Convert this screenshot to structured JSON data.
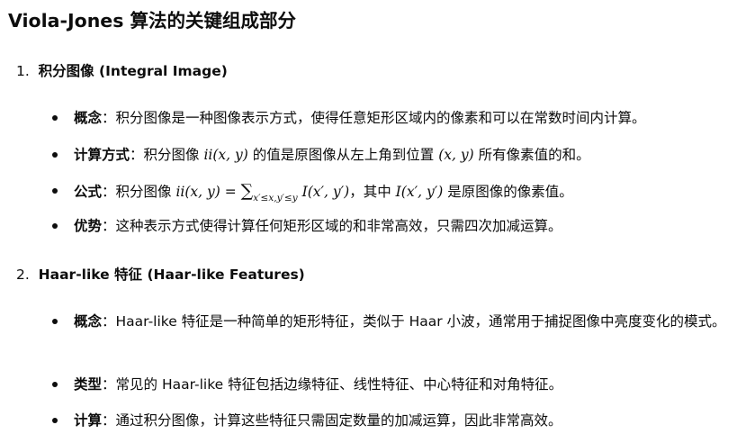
{
  "title": "Viola-Jones 算法的关键组成部分",
  "sections": [
    {
      "number": "1.",
      "title": "积分图像 (Integral Image)",
      "bullets": [
        {
          "label": "概念",
          "sep": "：",
          "text": "积分图像是一种图像表示方式，使得任意矩形区域内的像素和可以在常数时间内计算。"
        },
        {
          "label": "计算方式",
          "sep": "：",
          "t1": "积分图像 ",
          "m1": "ii(x, y)",
          "t2": " 的值是原图像从左上角到位置 ",
          "m2": "(x, y)",
          "t3": " 所有像素值的和。"
        },
        {
          "label": "公式",
          "sep": "：",
          "t1": "积分图像 ",
          "m1": "ii(x, y) = ",
          "sum": "∑",
          "lim": "x′≤x,y′≤y",
          "m2": " I(x′, y′)",
          "t2": "，其中 ",
          "m3": "I(x′, y′)",
          "t3": " 是原图像的像素值。"
        },
        {
          "label": "优势",
          "sep": "：",
          "text": "这种表示方式使得计算任何矩形区域的和非常高效，只需四次加减运算。"
        }
      ]
    },
    {
      "number": "2.",
      "title": "Haar-like 特征 (Haar-like Features)",
      "bullets": [
        {
          "label": "概念",
          "sep": "：",
          "text": "Haar-like 特征是一种简单的矩形特征，类似于 Haar 小波，通常用于捕捉图像中亮度变化的模式。"
        },
        {
          "label": "类型",
          "sep": "：",
          "text": "常见的 Haar-like 特征包括边缘特征、线性特征、中心特征和对角特征。"
        },
        {
          "label": "计算",
          "sep": "：",
          "text": "通过积分图像，计算这些特征只需固定数量的加减运算，因此非常高效。"
        }
      ]
    }
  ]
}
